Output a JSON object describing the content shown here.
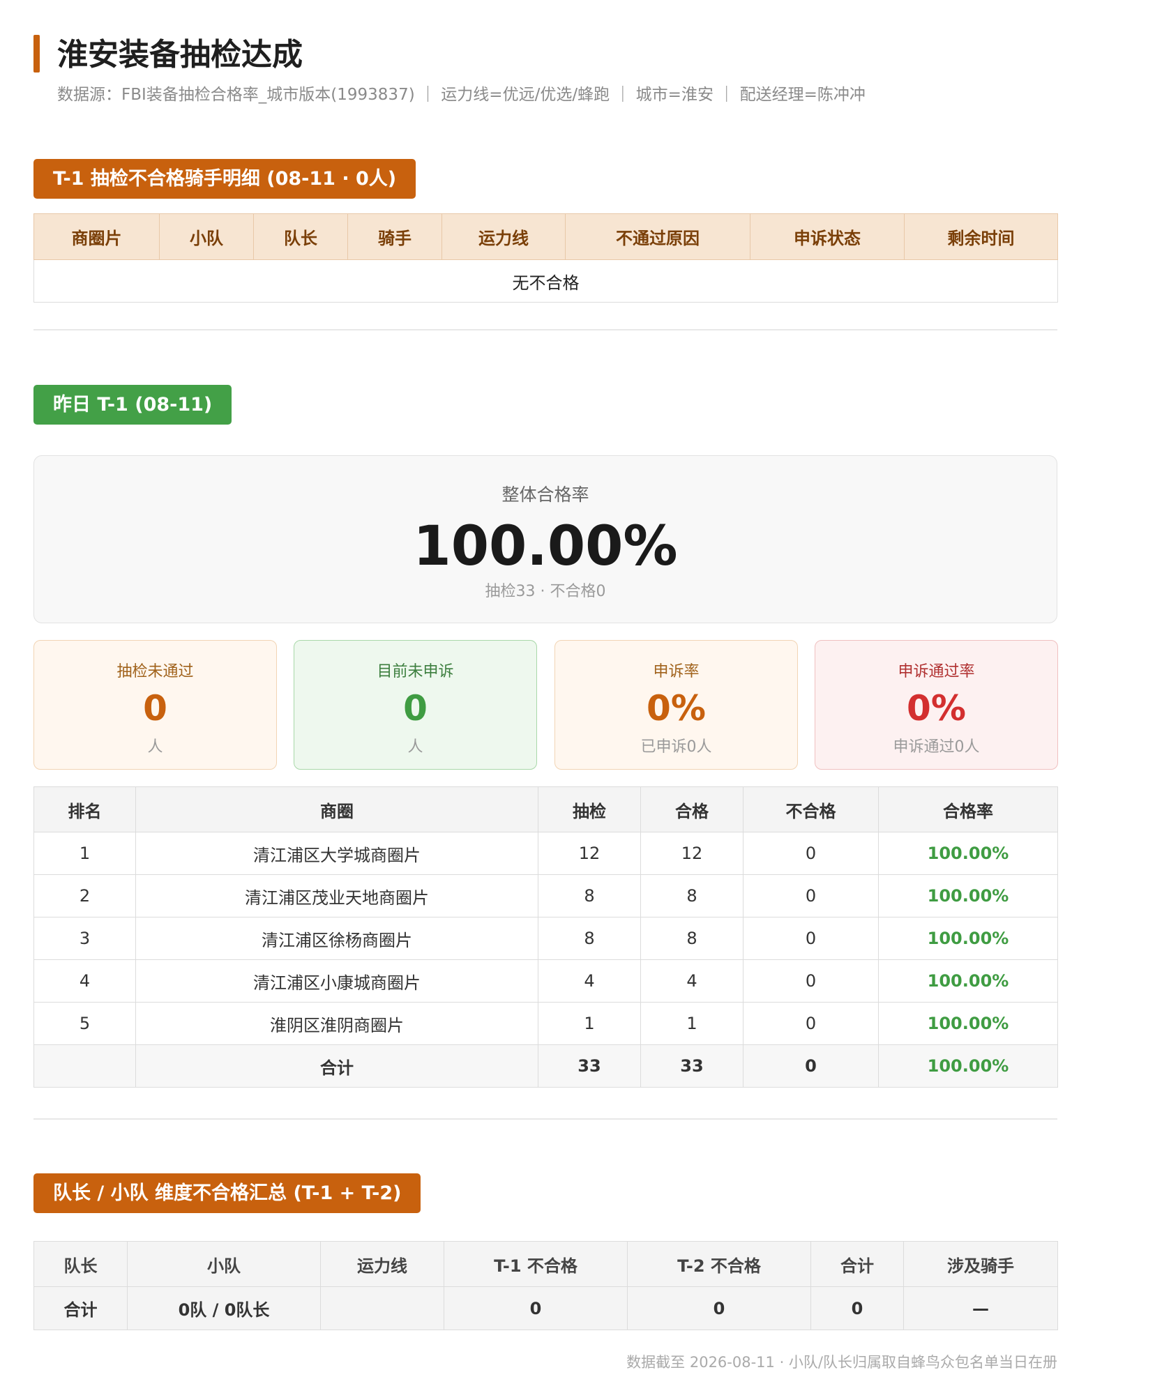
{
  "header": {
    "title": "淮安装备抽检达成",
    "subtitle": "数据源：FBI装备抽检合格率_城市版本(1993837) ｜ 运力线=优远/优选/蜂跑 ｜ 城市=淮安 ｜ 配送经理=陈冲冲"
  },
  "failed_detail": {
    "tag": "T-1 抽检不合格骑手明细 (08-11 · 0人)",
    "columns": [
      "商圈片",
      "小队",
      "队长",
      "骑手",
      "运力线",
      "不通过原因",
      "申诉状态",
      "剩余时间"
    ],
    "empty_text": "无不合格"
  },
  "yesterday": {
    "tag": "昨日 T-1 (08-11)",
    "overall": {
      "label": "整体合格率",
      "value": "100.00%",
      "sub": "抽检33 · 不合格0"
    },
    "cards": [
      {
        "label": "抽检未通过",
        "value": "0",
        "sub": "人"
      },
      {
        "label": "目前未申诉",
        "value": "0",
        "sub": "人"
      },
      {
        "label": "申诉率",
        "value": "0%",
        "sub": "已申诉0人"
      },
      {
        "label": "申诉通过率",
        "value": "0%",
        "sub": "申诉通过0人"
      }
    ],
    "columns": [
      "排名",
      "商圈",
      "抽检",
      "合格",
      "不合格",
      "合格率"
    ],
    "rows": [
      {
        "rank": "1",
        "area": "清江浦区大学城商圈片",
        "checked": "12",
        "passed": "12",
        "failed": "0",
        "rate": "100.00%"
      },
      {
        "rank": "2",
        "area": "清江浦区茂业天地商圈片",
        "checked": "8",
        "passed": "8",
        "failed": "0",
        "rate": "100.00%"
      },
      {
        "rank": "3",
        "area": "清江浦区徐杨商圈片",
        "checked": "8",
        "passed": "8",
        "failed": "0",
        "rate": "100.00%"
      },
      {
        "rank": "4",
        "area": "清江浦区小康城商圈片",
        "checked": "4",
        "passed": "4",
        "failed": "0",
        "rate": "100.00%"
      },
      {
        "rank": "5",
        "area": "淮阴区淮阴商圈片",
        "checked": "1",
        "passed": "1",
        "failed": "0",
        "rate": "100.00%"
      }
    ],
    "total": {
      "rank": "",
      "area": "合计",
      "checked": "33",
      "passed": "33",
      "failed": "0",
      "rate": "100.00%"
    }
  },
  "leader_summary": {
    "tag": "队长 / 小队 维度不合格汇总 (T-1 + T-2)",
    "columns": [
      "队长",
      "小队",
      "运力线",
      "T-1 不合格",
      "T-2 不合格",
      "合计",
      "涉及骑手"
    ],
    "total": {
      "leader": "合计",
      "team": "0队 / 0队长",
      "line": "",
      "t1": "0",
      "t2": "0",
      "sum": "0",
      "riders": "—"
    }
  },
  "footer": "数据截至 2026-08-11 · 小队/队长归属取自蜂鸟众包名单当日在册",
  "colors": {
    "accent_orange": "#c8610e",
    "accent_green": "#43a047",
    "rate_green": "#3f9c42",
    "alert_red": "#d32f2f"
  }
}
